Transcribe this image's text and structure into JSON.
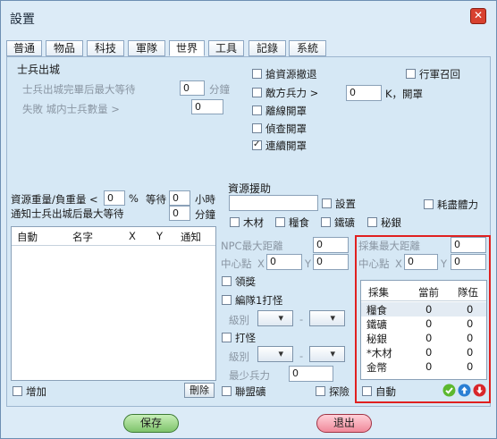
{
  "window": {
    "title": "設置"
  },
  "tabs": [
    "普通",
    "物品",
    "科技",
    "軍隊",
    "世界",
    "工具",
    "記錄",
    "系統"
  ],
  "soldier_out": {
    "heading": "士兵出城",
    "line1": "士兵出城完畢后最大等待",
    "line1_val": "0",
    "line1_unit": "分鐘",
    "line2": "失敗 城内士兵數量 >",
    "line2_val": "0"
  },
  "right_checks": {
    "grab_retreat": "搶資源撤退",
    "enemy_force": "敵方兵力 >",
    "enemy_val": "0",
    "enemy_unit": "K，開罩",
    "leave_shield": "離線開罩",
    "scout_shield": "偵查開罩",
    "continuous_shield": "連續開罩",
    "recall_march": "行軍召回"
  },
  "resource_weight": {
    "label1": "資源重量/負重量 <",
    "val1": "0",
    "pct": "%",
    "wait_label": "等待",
    "wait_val": "0",
    "hour_unit": "小時",
    "label2": "通知士兵出城后最大等待",
    "val2": "0",
    "min_unit": "分鐘"
  },
  "left_table": {
    "headers": [
      "自動",
      "名字",
      "X",
      "Y",
      "通知"
    ],
    "add_label": "增加",
    "delete_label": "刪除"
  },
  "aid": {
    "heading": "資源援助",
    "settings_label": "設置",
    "wood": "木材",
    "food": "糧食",
    "iron": "鐵礦",
    "silver": "秘銀",
    "stamina": "耗盡體力"
  },
  "npc": {
    "max_dist": "NPC最大距離",
    "max_val": "0",
    "center": "中心點",
    "x_label": "X",
    "x_val": "0",
    "y_label": "Y",
    "y_val": "0",
    "reward": "領獎",
    "edit_label": "編隊1打怪",
    "level1": "級別",
    "dash": "-",
    "fight": "打怪",
    "level2": "級別",
    "min_force": "最少兵力",
    "min_val": "0",
    "alliance": "聯盟礦",
    "explore": "探險"
  },
  "gather": {
    "max_dist": "採集最大距離",
    "max_val": "0",
    "center": "中心點",
    "x_label": "X",
    "x_val": "0",
    "y_label": "Y",
    "y_val": "0",
    "headers": [
      "採集",
      "當前",
      "隊伍"
    ],
    "rows": [
      {
        "name": "糧食",
        "cur": "0",
        "team": "0"
      },
      {
        "name": "鐵礦",
        "cur": "0",
        "team": "0"
      },
      {
        "name": "秘銀",
        "cur": "0",
        "team": "0"
      },
      {
        "name": "*木材",
        "cur": "0",
        "team": "0"
      },
      {
        "name": "金幣",
        "cur": "0",
        "team": "0"
      }
    ],
    "auto": "自動"
  },
  "footer": {
    "save": "保存",
    "exit": "退出"
  },
  "colors": {
    "highlight": "#e02020",
    "save": "#8fcf80",
    "exit": "#f08a9a",
    "confirm": "#5cb82e",
    "up": "#2a7fd4",
    "down": "#d8262b"
  }
}
